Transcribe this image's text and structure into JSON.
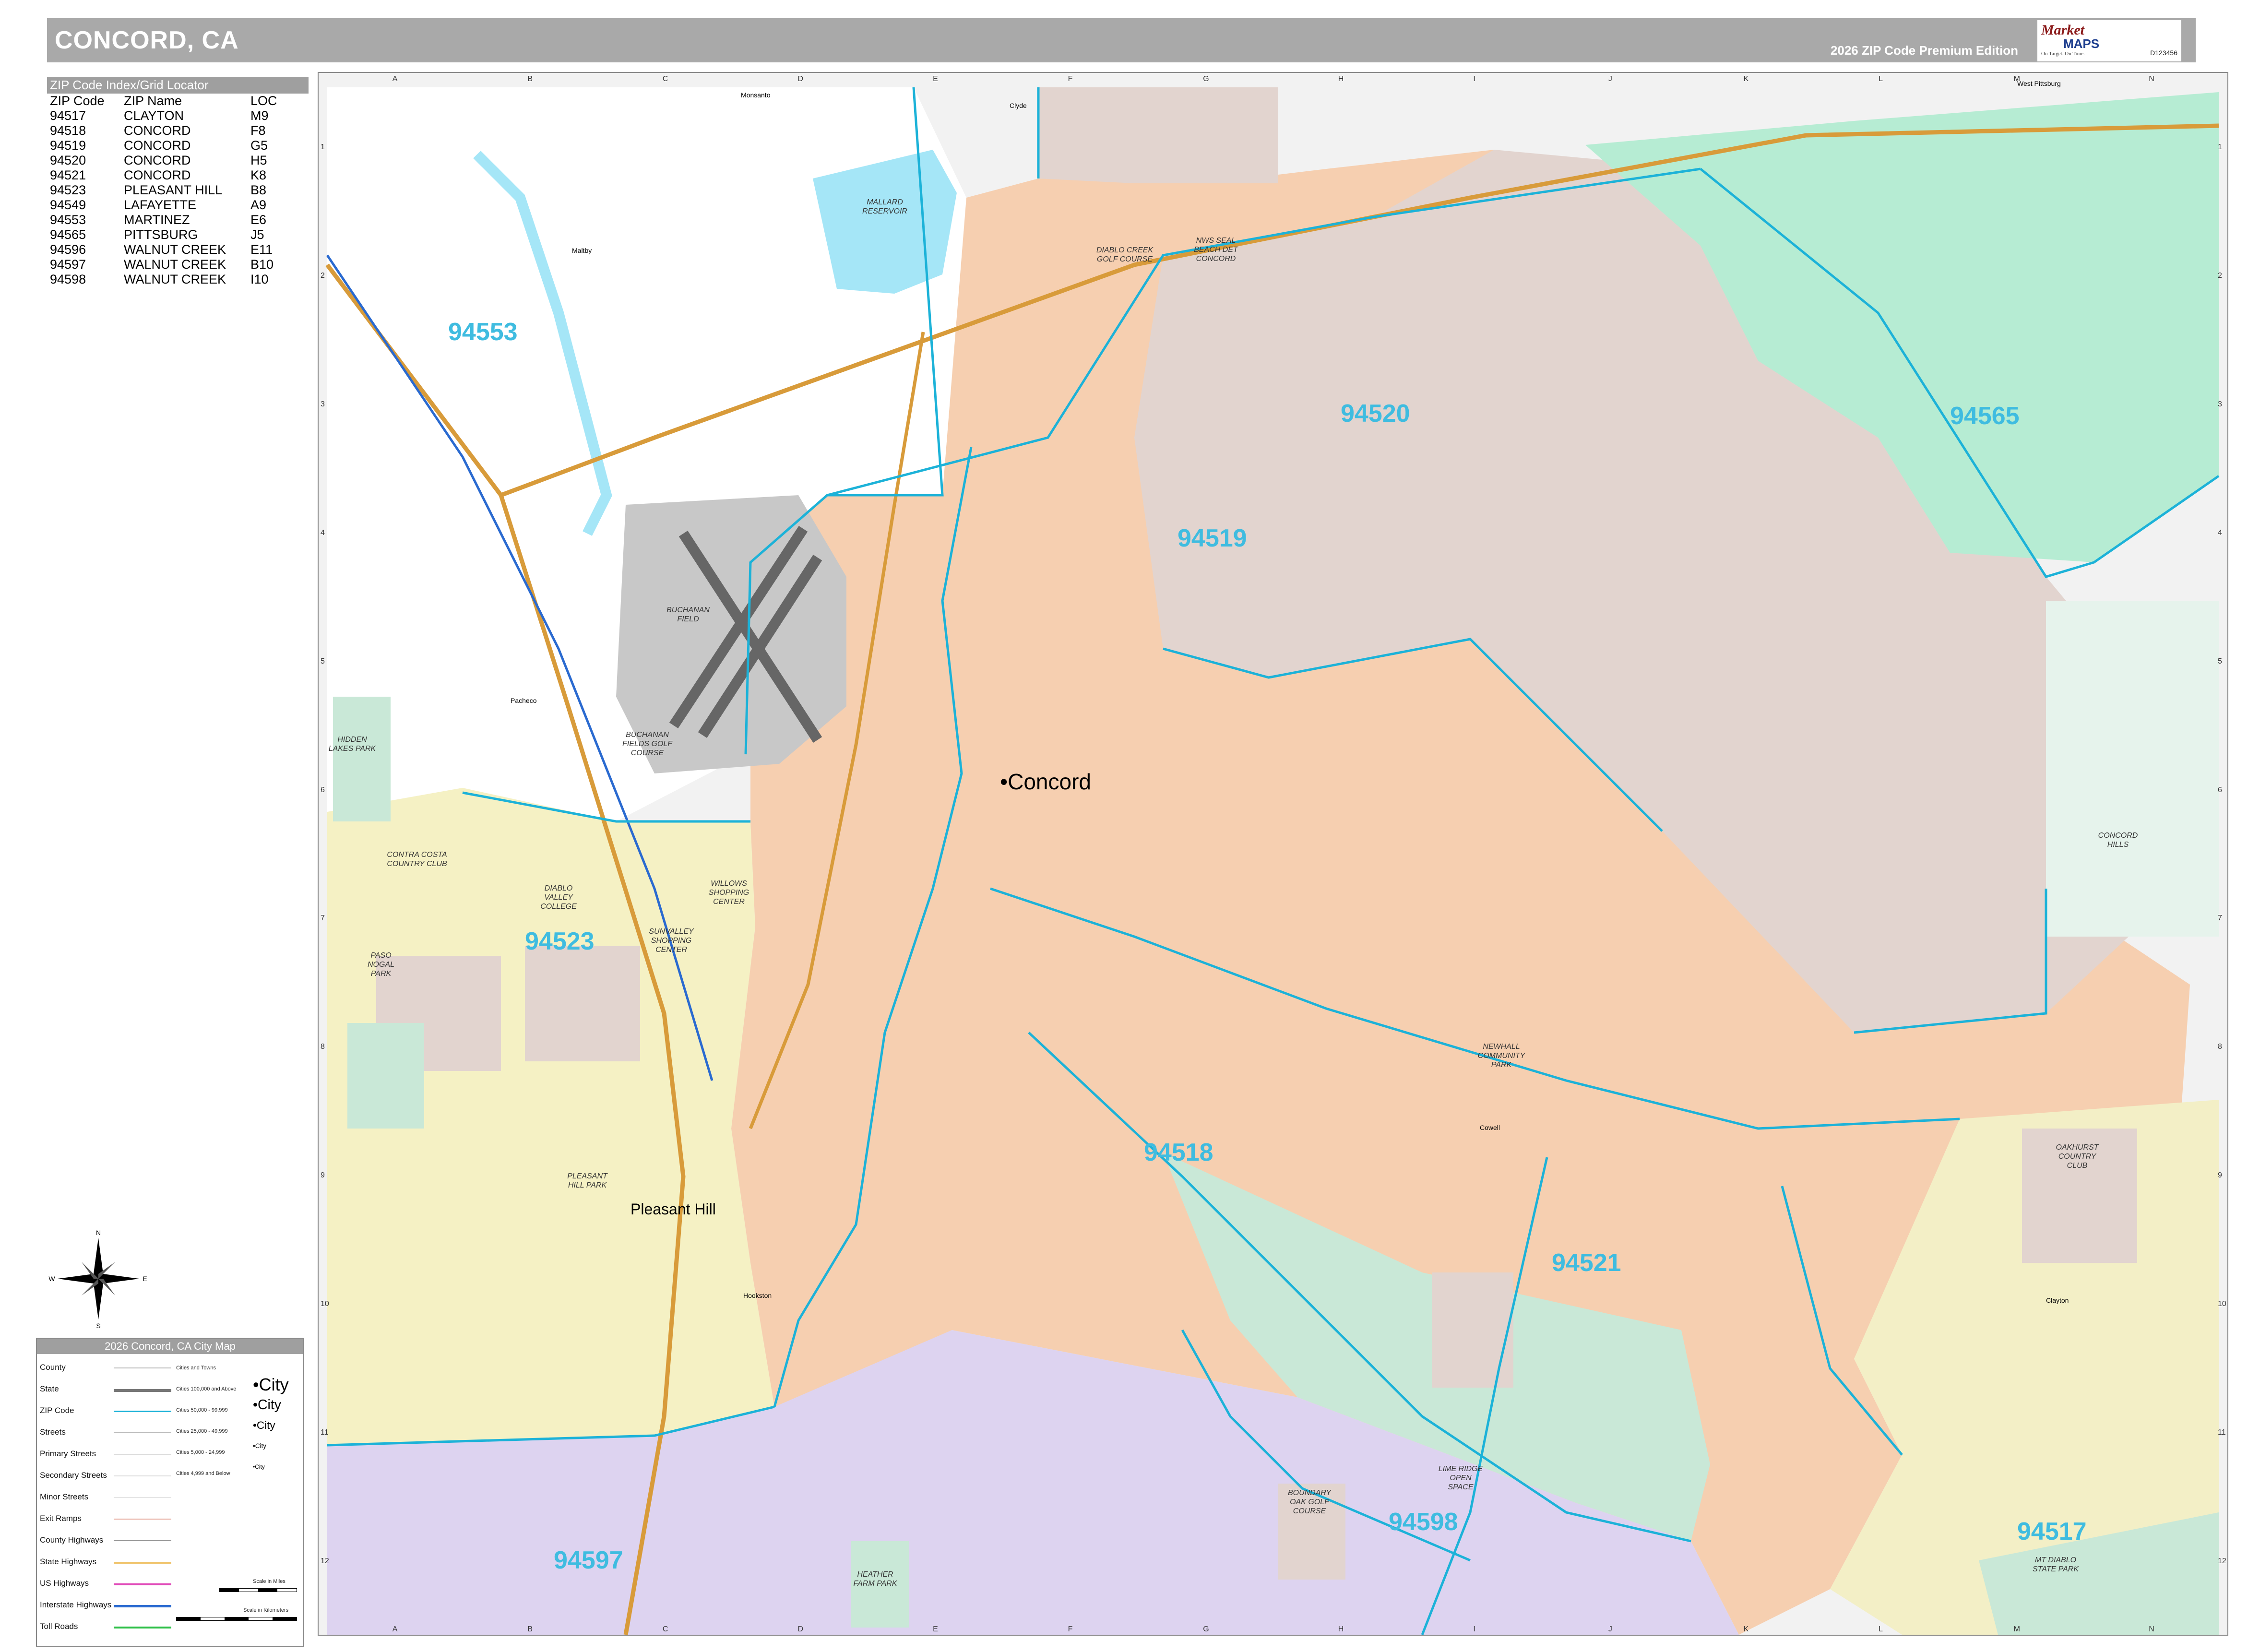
{
  "header": {
    "title": "CONCORD, CA",
    "edition": "2026 ZIP Code Premium Edition",
    "logo": {
      "market": "Market",
      "maps": "MAPS",
      "tagline": "On Target. On Time.",
      "product_id": "D123456"
    }
  },
  "zip_index": {
    "heading": "ZIP Code Index/Grid Locator",
    "columns": [
      "ZIP Code",
      "ZIP Name",
      "LOC"
    ],
    "rows": [
      [
        "94517",
        "CLAYTON",
        "M9"
      ],
      [
        "94518",
        "CONCORD",
        "F8"
      ],
      [
        "94519",
        "CONCORD",
        "G5"
      ],
      [
        "94520",
        "CONCORD",
        "H5"
      ],
      [
        "94521",
        "CONCORD",
        "K8"
      ],
      [
        "94523",
        "PLEASANT HILL",
        "B8"
      ],
      [
        "94549",
        "LAFAYETTE",
        "A9"
      ],
      [
        "94553",
        "MARTINEZ",
        "E6"
      ],
      [
        "94565",
        "PITTSBURG",
        "J5"
      ],
      [
        "94596",
        "WALNUT CREEK",
        "E11"
      ],
      [
        "94597",
        "WALNUT CREEK",
        "B10"
      ],
      [
        "94598",
        "WALNUT CREEK",
        "I10"
      ]
    ]
  },
  "grid": {
    "columns": [
      "A",
      "B",
      "C",
      "D",
      "E",
      "F",
      "G",
      "H",
      "I",
      "J",
      "K",
      "L",
      "M",
      "N"
    ],
    "rows": [
      "1",
      "2",
      "3",
      "4",
      "5",
      "6",
      "7",
      "8",
      "9",
      "10",
      "11",
      "12"
    ]
  },
  "map": {
    "zip_codes": [
      "94553",
      "94520",
      "94565",
      "94519",
      "94523",
      "94518",
      "94521",
      "94598",
      "94597",
      "94517"
    ],
    "cities": [
      "Concord",
      "Pleasant Hill",
      "Clayton",
      "Clyde",
      "Monsanto",
      "Maltby",
      "Pacheco",
      "Hookston",
      "Cowell",
      "West Pittsburg"
    ],
    "features": [
      "MALLARD RESERVOIR",
      "DIABLO CREEK GOLF COURSE",
      "NWS SEAL BEACH DET CONCORD",
      "BUCHANAN FIELD",
      "BUCHANAN FIELDS GOLF COURSE",
      "HIDDEN LAKES PARK",
      "CONTRA COSTA COUNTRY CLUB",
      "DIABLO VALLEY COLLEGE",
      "PASO NOGAL PARK",
      "SUNVALLEY SHOPPING CENTER",
      "WILLOWS SHOPPING CENTER",
      "CONCORD HILLS",
      "NEWHALL COMMUNITY PARK",
      "OAKHURST COUNTRY CLUB",
      "BOUNDARY OAK GOLF COURSE",
      "LIME RIDGE OPEN SPACE",
      "HEATHER FARM PARK",
      "MT DIABLO STATE PARK",
      "PLEASANT HILL PARK"
    ],
    "colors": {
      "concord_94518": "#f6cfb0",
      "navy_94520": "#e2d4cf",
      "pittsburg_94565": "#b6ecd3",
      "pleasant_hill_94523": "#f5f1c4",
      "walnut_creek_94597": "#ddd3f0",
      "clayton_94517": "#f3efc6",
      "zip_line": "#1cb2d8",
      "zip_label": "#3fbce0",
      "water": "#a5e6f7",
      "freeway": "#d89b3a"
    }
  },
  "legend": {
    "title": "2026 Concord, CA City Map",
    "rows": [
      "County",
      "State",
      "ZIP Code",
      "Streets",
      "Primary Streets",
      "Secondary Streets",
      "Minor Streets",
      "Exit Ramps",
      "County Highways",
      "State Highways",
      "US Highways",
      "Interstate Highways",
      "Toll Roads"
    ],
    "city_sizes": [
      {
        "label": "Cities and Towns",
        "sample": ""
      },
      {
        "label": "Cities 100,000 and Above",
        "sample": "•City"
      },
      {
        "label": "Cities 50,000 - 99,999",
        "sample": "•City"
      },
      {
        "label": "Cities 25,000 - 49,999",
        "sample": "•City"
      },
      {
        "label": "Cities 5,000 - 24,999",
        "sample": "•City"
      },
      {
        "label": "Cities 4,999 and Below",
        "sample": "•City"
      }
    ],
    "scale_miles": "Scale in Miles",
    "scale_km": "Scale in Kilometers"
  }
}
